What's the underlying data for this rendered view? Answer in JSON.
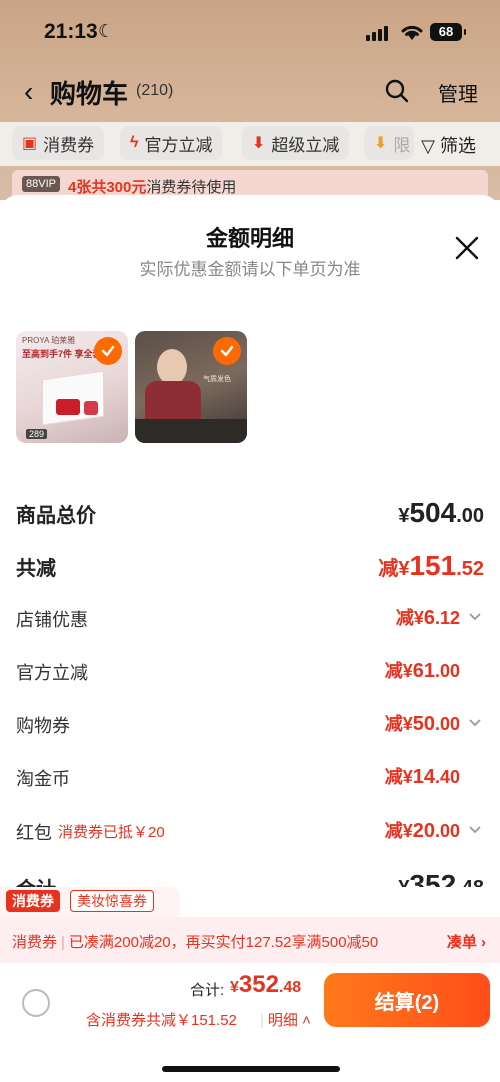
{
  "status": {
    "time": "21:13",
    "battery": "68"
  },
  "nav": {
    "title": "购物车",
    "count": "(210)",
    "manage": "管理"
  },
  "filters": {
    "chips": [
      "消费券",
      "官方立减",
      "超级立减",
      "限"
    ],
    "filter_label": "筛选"
  },
  "vip": {
    "badge": "88VIP",
    "highlight": "4张共300元",
    "text": "消费券待使用"
  },
  "sheet": {
    "title": "金额明细",
    "subtitle": "实际优惠金额请以下单页为准",
    "thumbs": [
      {
        "brand": "PROYA 珀莱雅",
        "headline": "至高到手7件 享全套",
        "price": "289"
      },
      {
        "headline": "气质发色"
      }
    ],
    "rows": {
      "goods_total": {
        "label": "商品总价",
        "pre": "¥",
        "int": "504",
        "dec": ".00"
      },
      "total_discount": {
        "label": "共减",
        "pre": "减¥",
        "int": "151",
        "dec": ".52"
      },
      "shop": {
        "label": "店铺优惠",
        "pre": "减¥",
        "int": "6",
        "dec": ".12"
      },
      "official": {
        "label": "官方立减",
        "pre": "减¥",
        "int": "61",
        "dec": ".00"
      },
      "coupon": {
        "label": "购物券",
        "pre": "减¥",
        "int": "50",
        "dec": ".00"
      },
      "taojinbi": {
        "label": "淘金币",
        "pre": "减¥",
        "int": "14",
        "dec": ".40"
      },
      "hongbao": {
        "label": "红包",
        "note": "消费券已抵￥20",
        "pre": "减¥",
        "int": "20",
        "dec": ".00"
      },
      "subtotal": {
        "label": "合计",
        "pre": "¥",
        "int": "352",
        "dec": ".48"
      }
    }
  },
  "tags": {
    "red": "消费券",
    "outline": "美妆惊喜券"
  },
  "promo": {
    "tag": "消费券",
    "text": "已凑满200减20，再买实付127.52享满500减50",
    "action": "凑单"
  },
  "bottom": {
    "sum_label": "合计:",
    "sum_pre": "¥",
    "sum_int": "352",
    "sum_dec": ".48",
    "note": "含消费券共减￥151.52",
    "detail": "明细",
    "checkout": "结算(2)"
  },
  "colors": {
    "accent": "#e8321e",
    "checkout": "#ff5a1a"
  }
}
